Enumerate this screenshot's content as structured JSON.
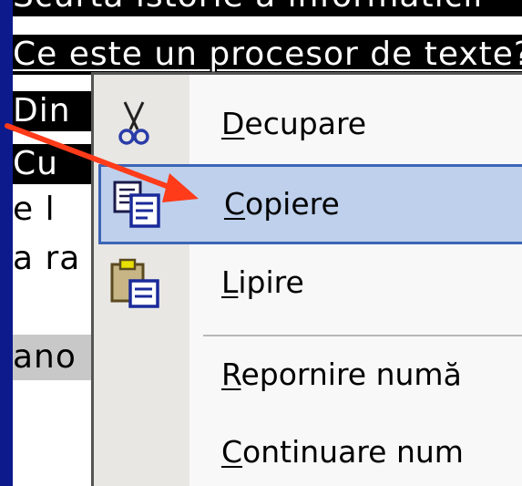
{
  "document": {
    "lines": [
      "Scurtă istorie a informaticii",
      "Ce este un procesor de texte?",
      "Din",
      "Cu",
      "e l",
      "a ra",
      "ano"
    ]
  },
  "context_menu": {
    "items": [
      {
        "icon": "scissors-icon",
        "accel": "D",
        "rest": "ecupare",
        "selected": false
      },
      {
        "icon": "copy-icon",
        "accel": "C",
        "rest": "opiere",
        "selected": true
      },
      {
        "icon": "paste-icon",
        "accel": "L",
        "rest": "ipire",
        "selected": false
      },
      {
        "icon": null,
        "accel": "R",
        "rest": "epornire numă",
        "selected": false
      },
      {
        "icon": null,
        "accel": "C",
        "rest": "ontinuare num",
        "selected": false
      }
    ]
  },
  "colors": {
    "background": "#0c1a8c",
    "highlight": "#bed0ec",
    "highlight_border": "#3d65b6",
    "arrow": "#ff3b1a"
  }
}
